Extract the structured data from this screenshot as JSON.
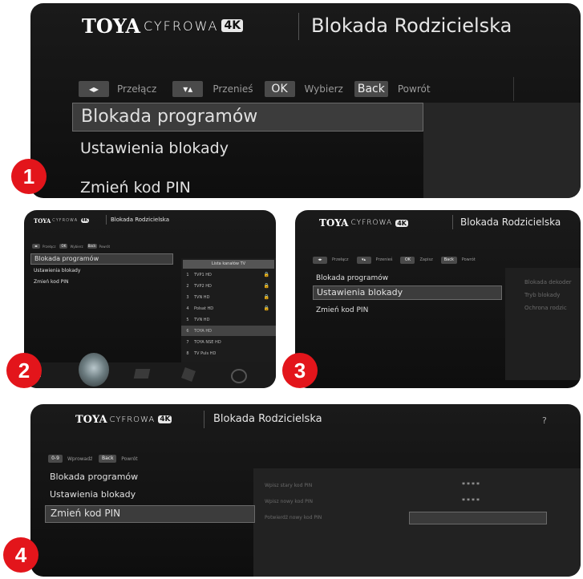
{
  "app": {
    "brand": "TOYA",
    "brand_sub": "CYFROWA",
    "brand_badge": "4K",
    "screen_title": "Blokada Rodzicielska"
  },
  "hints": {
    "key_arrows": "◂▸",
    "switch_label": "Przełącz",
    "key_move": "▾▴",
    "move_label": "Przenieś",
    "key_ok": "OK",
    "select_label": "Wybierz",
    "key_back": "Back",
    "back_label": "Powrót",
    "save_label": "Zapisz",
    "key_digits": "0-9",
    "enter_label": "Wprowadź"
  },
  "menu": [
    "Blokada programów",
    "Ustawienia blokady",
    "Zmień kod PIN"
  ],
  "steps": [
    "1",
    "2",
    "3",
    "4"
  ],
  "panel2": {
    "channel_list_header": "Lista kanałów TV",
    "channels": [
      {
        "num": "1",
        "name": "TVP1 HD"
      },
      {
        "num": "2",
        "name": "TVP2 HD"
      },
      {
        "num": "3",
        "name": "TVN HD"
      },
      {
        "num": "4",
        "name": "Polsat HD"
      },
      {
        "num": "5",
        "name": "TVN HD"
      },
      {
        "num": "6",
        "name": "TOYA HD"
      },
      {
        "num": "7",
        "name": "TOYA NSE HD"
      },
      {
        "num": "8",
        "name": "TV Puls HD"
      }
    ]
  },
  "panel3": {
    "options": [
      "Blokada dekoder",
      "Tryb blokady",
      "Ochrona rodzic"
    ]
  },
  "panel4": {
    "help": "?",
    "fields": [
      {
        "label": "Wpisz stary kod PIN",
        "value": "****"
      },
      {
        "label": "Wpisz nowy kod PIN",
        "value": "****"
      },
      {
        "label": "Potwierdź nowy kod PIN",
        "value": ""
      }
    ]
  }
}
